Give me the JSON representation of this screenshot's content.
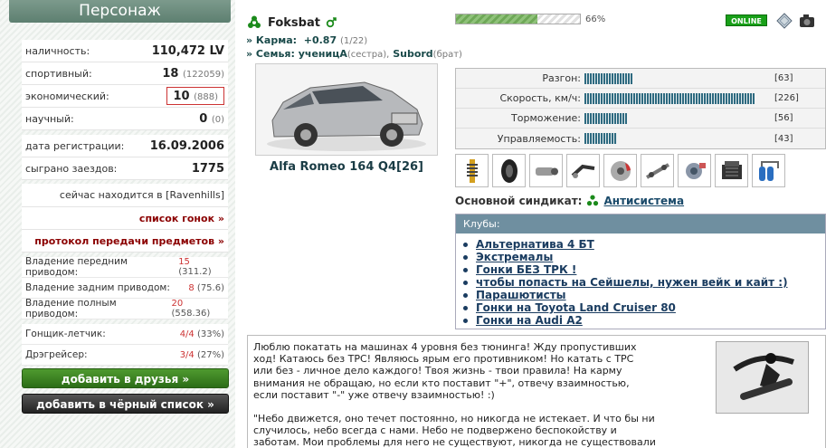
{
  "sidebar": {
    "title": "Персонаж",
    "stats": [
      {
        "label": "наличность:",
        "value": "110,472 LV",
        "extra": ""
      },
      {
        "label": "спортивный:",
        "value": "18",
        "extra": "(122059)"
      },
      {
        "label": "экономический:",
        "value": "10",
        "extra": "(888)"
      },
      {
        "label": "научный:",
        "value": "0",
        "extra": "(0)"
      }
    ],
    "reg_label": "дата регистрации:",
    "reg_value": "16.09.2006",
    "races_label": "сыграно заездов:",
    "races_value": "1775",
    "location_text": "сейчас находится в [",
    "location_city": "Ravenhills",
    "location_end": "]",
    "race_list_link": "список гонок »",
    "transfer_link": "протокол передачи предметов »",
    "drive": [
      {
        "label": "Владение передним приводом:",
        "num": "15",
        "pct": "(311.2)"
      },
      {
        "label": "Владение задним приводом:",
        "num": "8",
        "pct": "(75.6)"
      },
      {
        "label": "Владение полным приводом:",
        "num": "20",
        "pct": "(558.36)"
      }
    ],
    "racer_label": "Гонщик-летчик:",
    "racer_num": "4/4",
    "racer_pct": "(33%)",
    "drag_label": "Дрэгрейсер:",
    "drag_num": "3/4",
    "drag_pct": "(27%)",
    "add_friend": "добавить в друзья »",
    "add_black": "добавить в чёрный список »"
  },
  "profile": {
    "username": "Foksbat",
    "karma_label": "» Карма:",
    "karma_value": "+0.87",
    "karma_extra": "(1/22)",
    "family_label": "» Семья:",
    "family_member1": "ученицА",
    "family_role1": "(сестра),",
    "family_member2": "Subord",
    "family_role2": "(брат)",
    "car_name": "Alfa Romeo 164 Q4[26]",
    "progress_pct": 66,
    "progress_text": "66%",
    "status": "ONLINE"
  },
  "performance": [
    {
      "label": "Разгон:",
      "value": 63,
      "text": "[63]"
    },
    {
      "label": "Скорость, км/ч:",
      "value": 226,
      "text": "[226]"
    },
    {
      "label": "Торможение:",
      "value": 56,
      "text": "[56]"
    },
    {
      "label": "Управляемость:",
      "value": 43,
      "text": "[43]"
    }
  ],
  "parts": [
    "suspension-icon",
    "tire-icon",
    "exhaust-icon",
    "intake-icon",
    "brake-icon",
    "shaft-icon",
    "turbo-icon",
    "engine-icon",
    "nitro-icon"
  ],
  "syndicate": {
    "label": "Основной синдикат:",
    "name": "Антисистема"
  },
  "clubs": {
    "header": "Клубы:",
    "items": [
      "Альтернатива 4 БТ",
      "Экстремалы",
      "Гонки БЕЗ ТРК !",
      "чтобы попасть на Сейшелы, нужен вейк и кайт :)",
      "Парашютисты",
      "Гонки на Toyota Land Cruiser 80",
      "Гонки на Audi A2"
    ]
  },
  "description": {
    "p1": "Люблю покатать на машинах 4 уровня без тюнинга! Жду пропустивших ход! Катаюсь без ТРС! Являюсь ярым его противником! Но катать с ТРС или без - личное дело каждого! Твоя жизнь - твои правила! На карму внимания не обращаю, но если кто поставит \"+\", отвечу взаимностью, если поставит \"-\" уже отвечу взаимностью! :)",
    "p2": "\"Небо движется, оно течет постоянно, но никогда не истекает. И что бы ни случилось, небо всегда с нами. Небо не подвержено беспокойству и заботам. Мои проблемы для него не существуют, никогда не существовали и никогда не будут"
  }
}
